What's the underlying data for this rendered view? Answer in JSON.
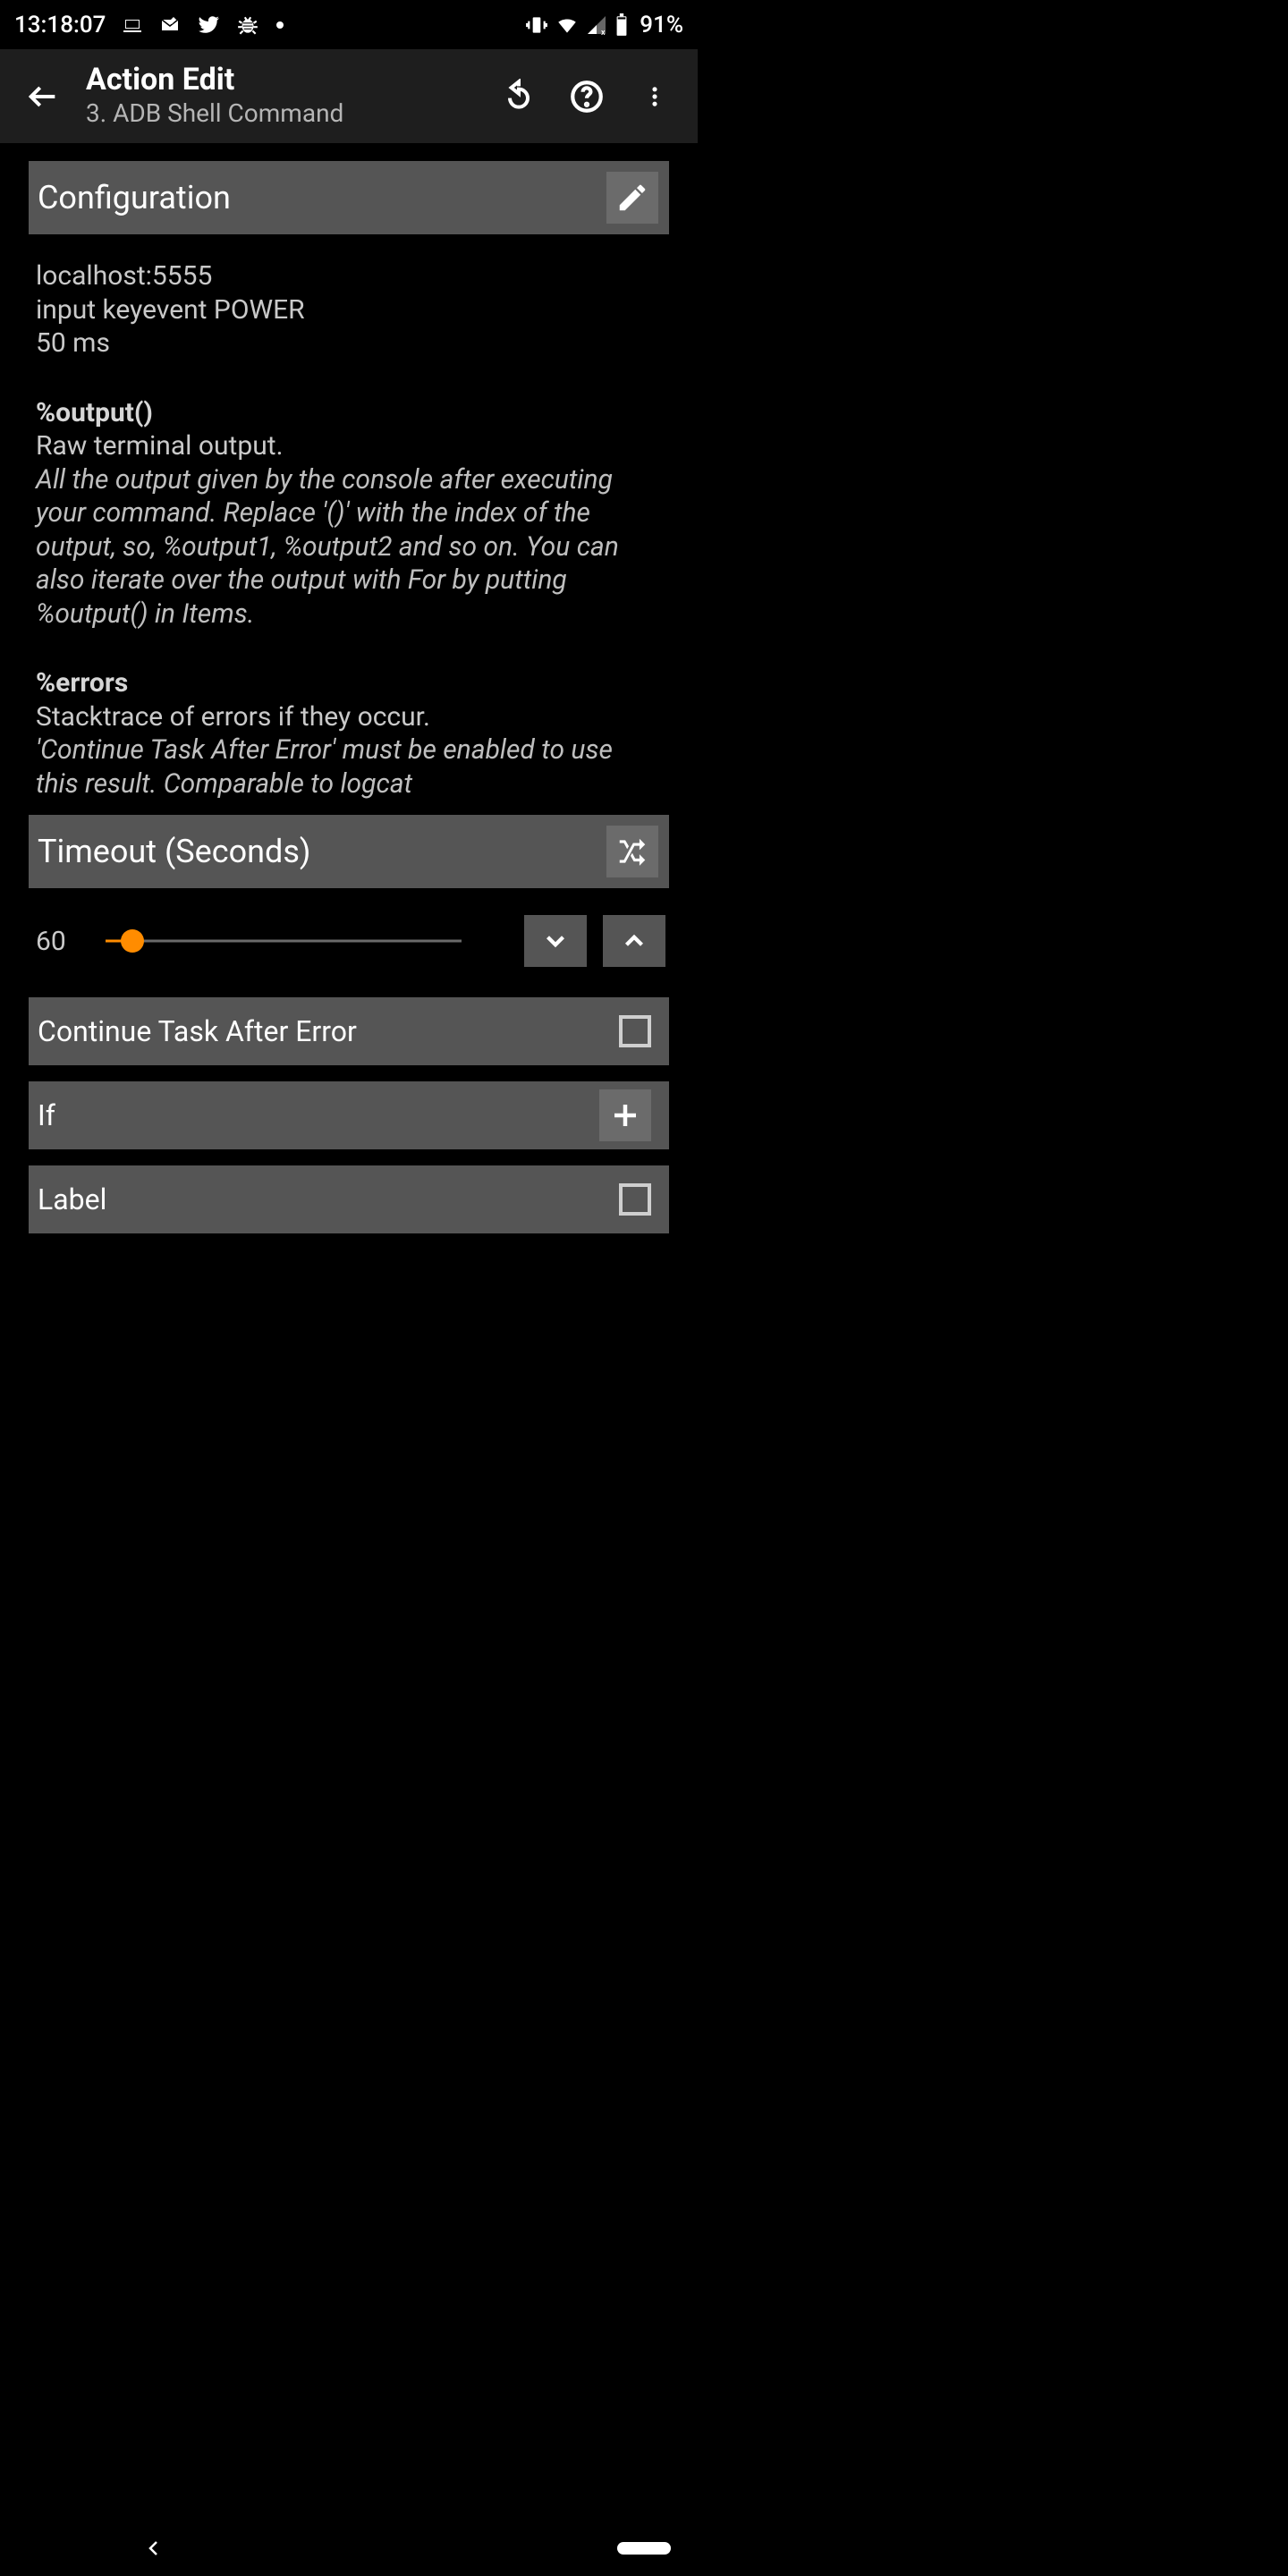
{
  "status": {
    "time": "13:18:07",
    "battery": "91%"
  },
  "appbar": {
    "title": "Action Edit",
    "subtitle": "3. ADB Shell Command"
  },
  "sections": {
    "configuration": {
      "header": "Configuration",
      "value_lines": [
        "localhost:5555",
        "input keyevent POWER",
        "50 ms"
      ],
      "vars": [
        {
          "name": "%output()",
          "short": "Raw terminal output.",
          "desc": "All the output given by the console after executing your command. Replace '()' with the index of the output, so, %output1, %output2 and so on. You can also iterate over the output with For by putting %output() in Items."
        },
        {
          "name": "%errors",
          "short": "Stacktrace of errors if they occur.",
          "desc": "'Continue Task After Error' must be enabled to use this result. Comparable to logcat"
        }
      ]
    },
    "timeout": {
      "header": "Timeout (Seconds)",
      "value": "60"
    },
    "continue_after_error": {
      "label": "Continue Task After Error",
      "checked": false
    },
    "if": {
      "label": "If"
    },
    "label_row": {
      "label": "Label",
      "checked": false
    }
  }
}
